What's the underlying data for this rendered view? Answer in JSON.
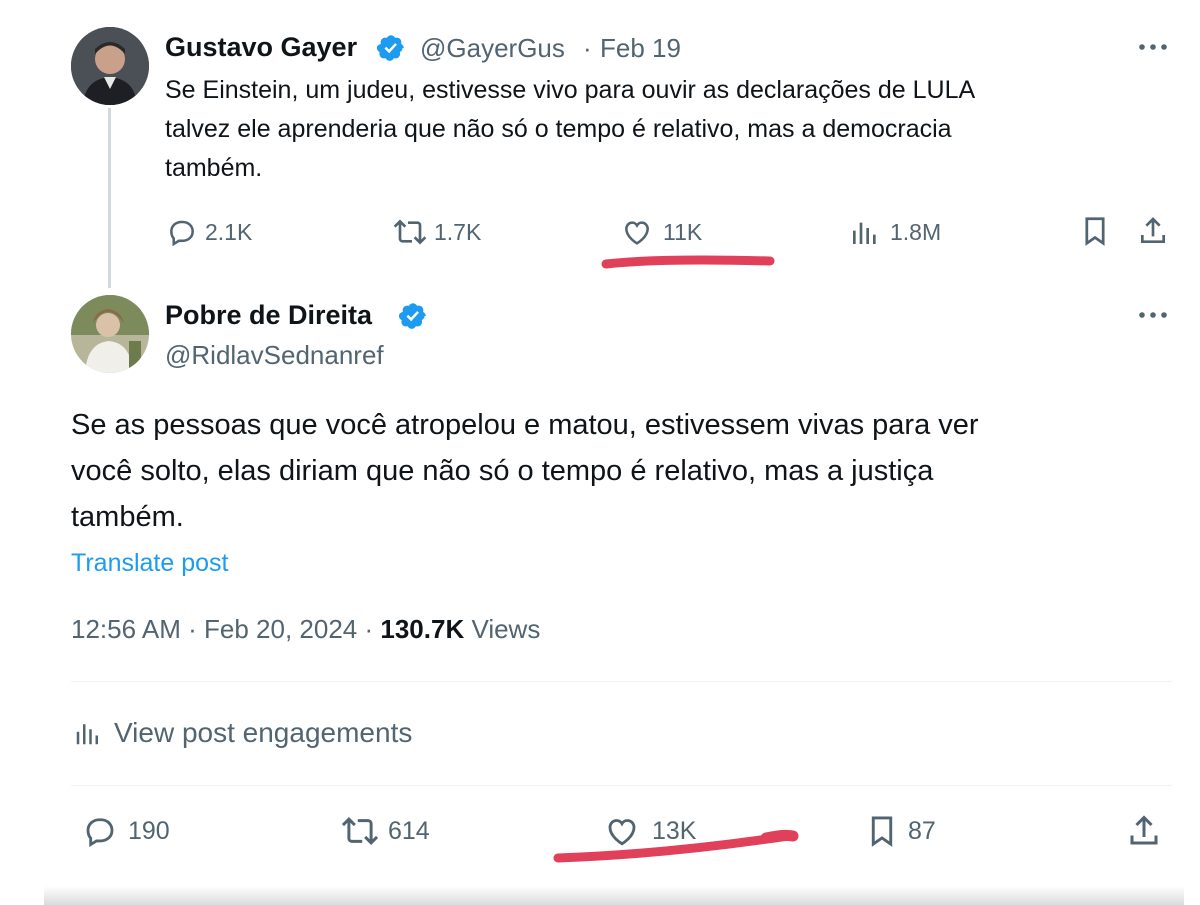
{
  "reply_to": {
    "name": "Gustavo Gayer",
    "handle": "@GayerGus",
    "separator": "·",
    "date": "Feb 19",
    "text_lines": [
      "Se Einstein, um judeu, estivesse vivo para ouvir as declarações de LULA",
      "talvez ele aprenderia que não só o tempo é relativo, mas a democracia",
      "também."
    ],
    "actions": {
      "replies": "2.1K",
      "reposts": "1.7K",
      "likes": "11K",
      "views": "1.8M"
    },
    "icons": [
      "verified-badge-icon",
      "more-icon",
      "reply-icon",
      "repost-icon",
      "like-icon",
      "views-icon",
      "bookmark-icon",
      "share-icon"
    ]
  },
  "main_post": {
    "name": "Pobre de Direita",
    "handle": "@RidlavSednanref",
    "text_lines": [
      "Se as pessoas que você atropelou e matou, estivessem vivas para ver",
      "você solto, elas diriam que não só o tempo é relativo, mas a justiça",
      "também."
    ],
    "translate_label": "Translate post",
    "meta": {
      "time": "12:56 AM",
      "sep1": "·",
      "date": "Feb 20, 2024",
      "sep2": "·",
      "views_count": "130.7K",
      "views_label": "Views"
    },
    "engagements_label": "View post engagements",
    "actions": {
      "replies": "190",
      "reposts": "614",
      "likes": "13K",
      "bookmarks": "87"
    }
  },
  "colors": {
    "verified_blue": "#1d9bf0",
    "link_blue": "#1d9bf0",
    "annotation_red": "#e0405a",
    "muted": "#536471"
  }
}
